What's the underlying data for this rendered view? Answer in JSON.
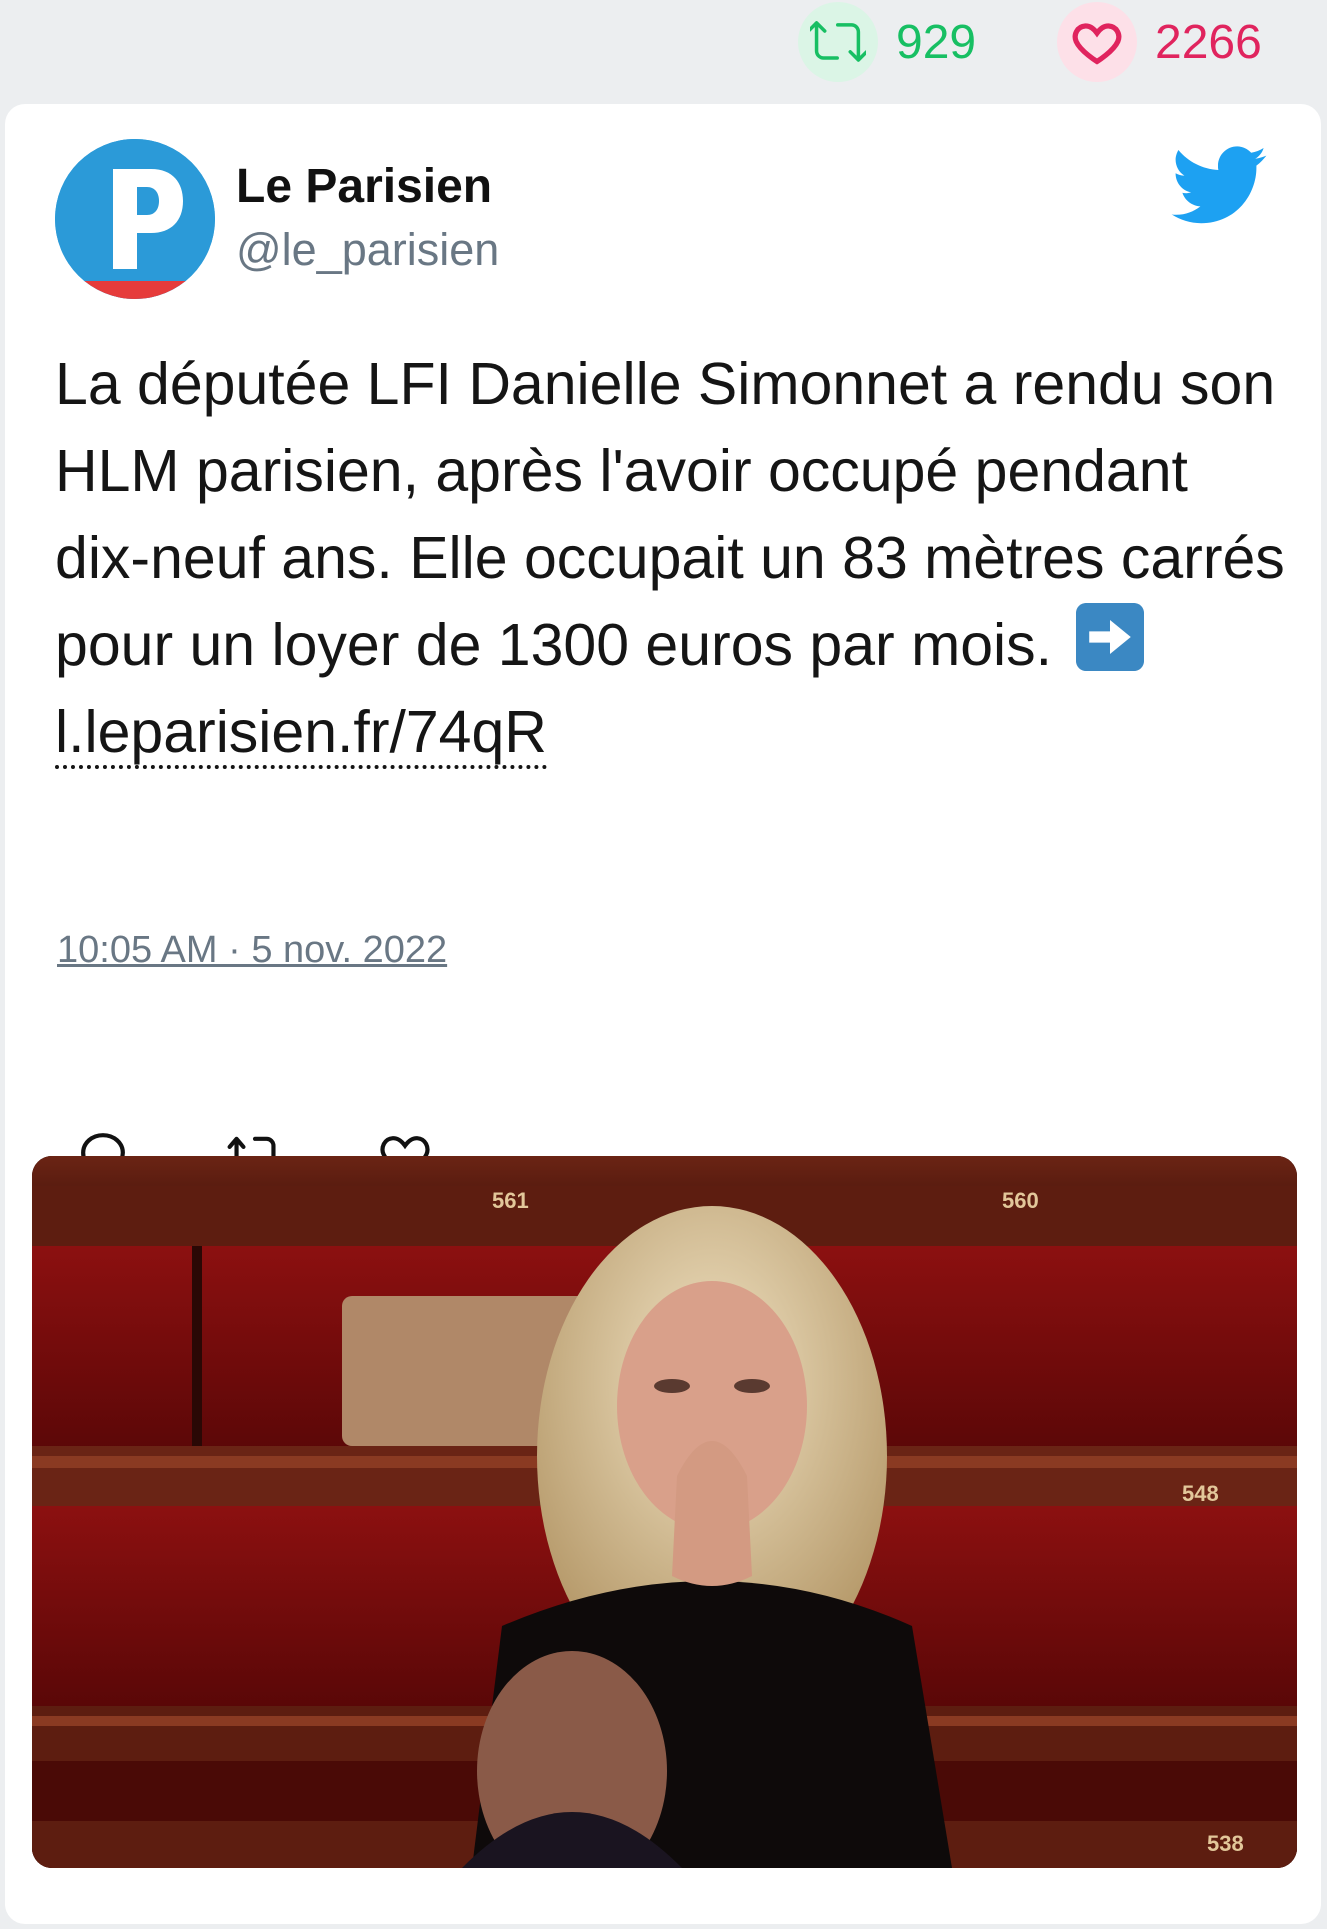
{
  "stats": {
    "retweets": "929",
    "likes": "2266",
    "retweet_color": "#17bf63",
    "like_color": "#e0245e"
  },
  "author": {
    "name": "Le Parisien",
    "handle": "@le_parisien",
    "avatar_letter": "P",
    "avatar_color": "#2b9ad8"
  },
  "tweet": {
    "text": "La députée LFI Danielle Simonnet a rendu son HLM parisien, après l'avoir occupé pendant dix-neuf ans. Elle occupait un 83 mètres carrés pour un loyer de 1300 euros par mois.",
    "emoji": "right-arrow-emoji",
    "link": "l.leparisien.fr/74qR",
    "timestamp": "10:05 AM · 5 nov. 2022"
  },
  "actions": {
    "reply": "reply-icon",
    "retweet": "retweet-icon",
    "like": "heart-icon"
  },
  "photo": {
    "seat_labels": [
      "561",
      "560",
      "548",
      "538"
    ]
  },
  "brand": {
    "twitter_blue": "#1da1f2"
  }
}
